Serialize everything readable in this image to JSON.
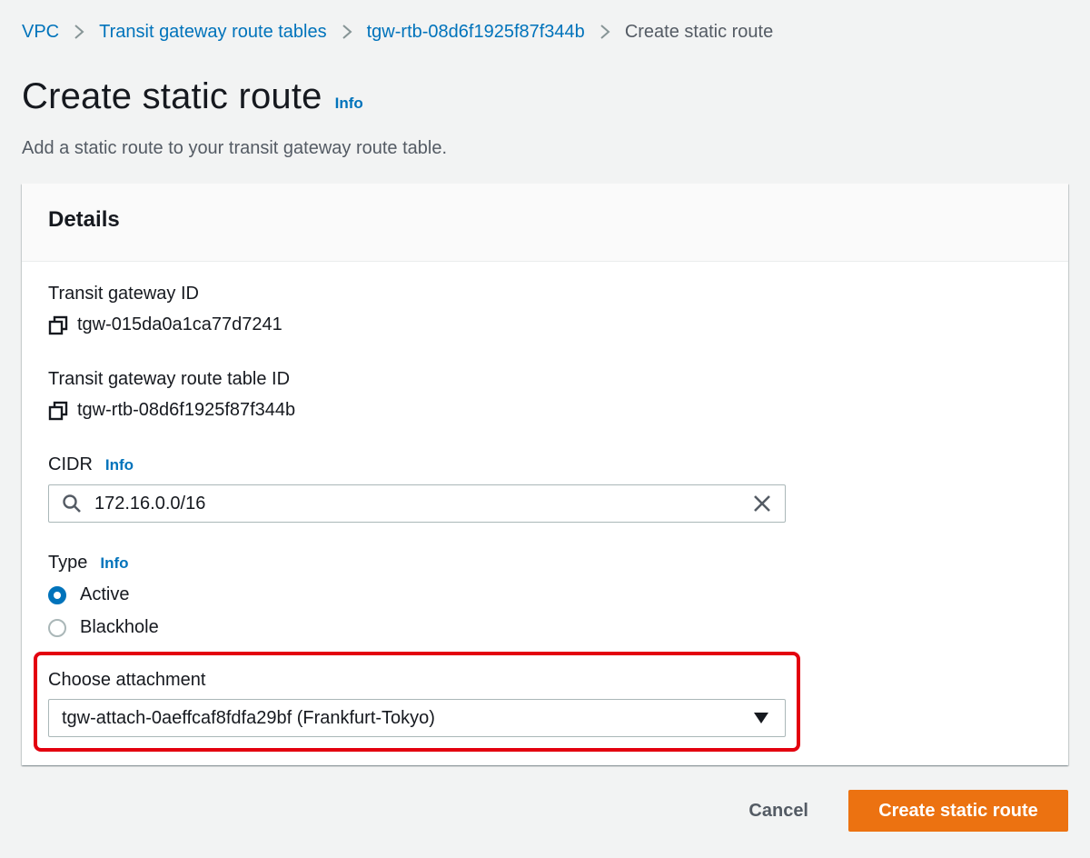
{
  "breadcrumb": {
    "items": [
      {
        "label": "VPC"
      },
      {
        "label": "Transit gateway route tables"
      },
      {
        "label": "tgw-rtb-08d6f1925f87f344b"
      },
      {
        "label": "Create static route"
      }
    ]
  },
  "page": {
    "title": "Create static route",
    "info": "Info",
    "description": "Add a static route to your transit gateway route table."
  },
  "details": {
    "heading": "Details",
    "tgw_id_label": "Transit gateway ID",
    "tgw_id_value": "tgw-015da0a1ca77d7241",
    "rtb_id_label": "Transit gateway route table ID",
    "rtb_id_value": "tgw-rtb-08d6f1925f87f344b",
    "cidr_label": "CIDR",
    "cidr_info": "Info",
    "cidr_value": "172.16.0.0/16",
    "type_label": "Type",
    "type_info": "Info",
    "type_options": [
      {
        "label": "Active",
        "selected": true
      },
      {
        "label": "Blackhole",
        "selected": false
      }
    ],
    "attachment_label": "Choose attachment",
    "attachment_value": "tgw-attach-0aeffcaf8fdfa29bf (Frankfurt-Tokyo)"
  },
  "actions": {
    "cancel_label": "Cancel",
    "submit_label": "Create static route"
  },
  "icons": {
    "copy": "copy-icon",
    "search": "search-icon",
    "clear": "close-icon",
    "caret": "caret-down-icon",
    "separator": "chevron-right-icon"
  },
  "colors": {
    "link": "#0073bb",
    "primary_button": "#ec7211",
    "highlight": "#e3000f",
    "background": "#f2f3f3"
  }
}
